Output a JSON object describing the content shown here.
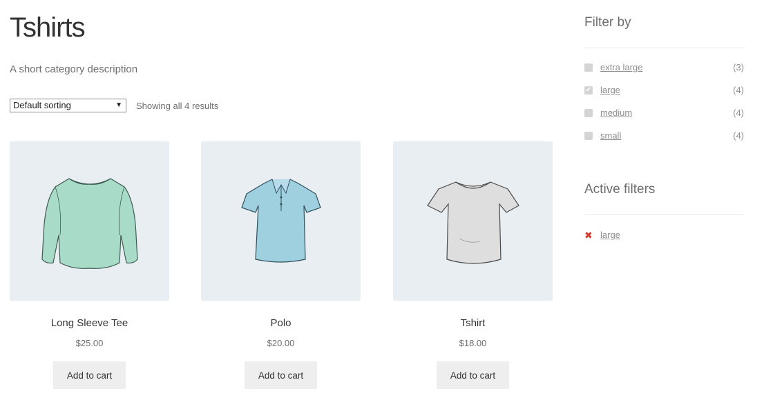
{
  "page": {
    "title": "Tshirts",
    "description": "A short category description"
  },
  "toolbar": {
    "sort_selected": "Default sorting",
    "result_count": "Showing all 4 results"
  },
  "products": [
    {
      "name": "Long Sleeve Tee",
      "price": "$25.00",
      "button": "Add to cart",
      "image": "long-sleeve-tee",
      "color": "#a8dcc8"
    },
    {
      "name": "Polo",
      "price": "$20.00",
      "button": "Add to cart",
      "image": "polo-shirt",
      "color": "#9fd0e0"
    },
    {
      "name": "Tshirt",
      "price": "$18.00",
      "button": "Add to cart",
      "image": "tshirt",
      "color": "#dedede"
    }
  ],
  "sidebar": {
    "filter_title": "Filter by",
    "filters": [
      {
        "label": "extra large",
        "count": "(3)",
        "checked": false
      },
      {
        "label": "large",
        "count": "(4)",
        "checked": true
      },
      {
        "label": "medium",
        "count": "(4)",
        "checked": false
      },
      {
        "label": "small",
        "count": "(4)",
        "checked": false
      }
    ],
    "active_title": "Active filters",
    "active_filters": [
      {
        "label": "large",
        "remove_icon": "close-icon"
      }
    ]
  },
  "colors": {
    "thumb_bg": "#e9eef2",
    "remove_red": "#d33c2c",
    "button_bg": "#eeeeee"
  }
}
